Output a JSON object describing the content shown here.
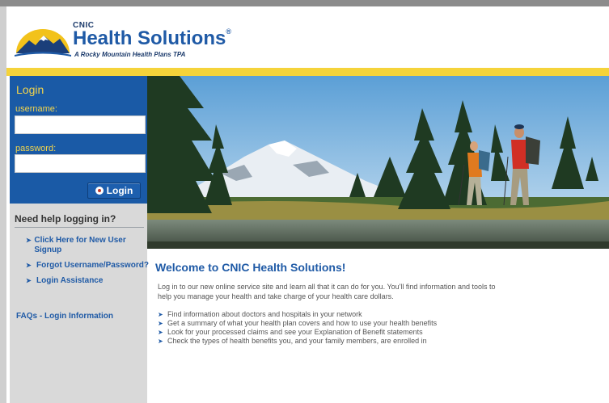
{
  "brand": {
    "small": "CNIC",
    "name": "Health Solutions",
    "registered": "®",
    "tagline": "A Rocky Mountain Health Plans TPA"
  },
  "colors": {
    "blue": "#1a5aa6",
    "yellow": "#f5d33a",
    "label_yellow": "#f4d54b",
    "link_blue": "#1f5aa6"
  },
  "login": {
    "title": "Login",
    "username_label": "username:",
    "username_value": "",
    "password_label": "password:",
    "password_value": "",
    "button": "Login"
  },
  "help": {
    "title": "Need help logging in?",
    "items": [
      {
        "label": "Click Here for New User Signup"
      },
      {
        "label": "Forgot Username/Password?"
      },
      {
        "label": "Login Assistance"
      }
    ]
  },
  "faq": "FAQs - Login Information",
  "main": {
    "title": "Welcome to CNIC Health Solutions!",
    "intro": "Log in to our new online service site and learn all that it can do for you. You'll find information and tools to help you manage your health and take charge of your health care dollars.",
    "bullets": [
      "Find information about doctors and hospitals in your network",
      "Get a summary of what your health plan covers and how to use your health benefits",
      "Look for your processed claims and see your Explanation of Benefit statements",
      "Check the types of health benefits you, and your family members, are enrolled in"
    ]
  }
}
